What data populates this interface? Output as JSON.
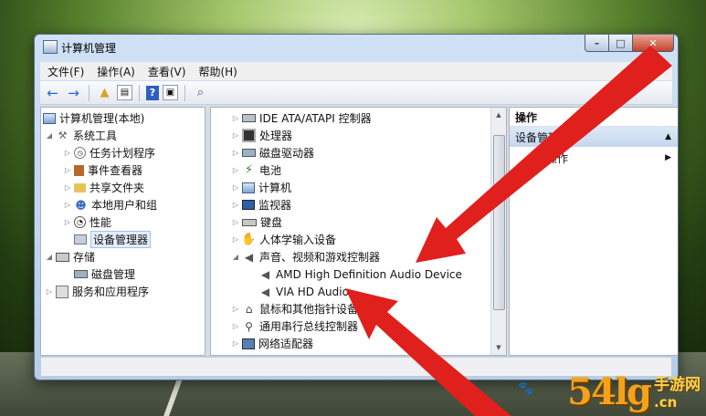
{
  "window": {
    "title": "计算机管理",
    "controls": {
      "minimize": "–",
      "maximize": "□",
      "close": "✕"
    }
  },
  "menubar": [
    {
      "label": "文件(F)"
    },
    {
      "label": "操作(A)"
    },
    {
      "label": "查看(V)"
    },
    {
      "label": "帮助(H)"
    }
  ],
  "toolbar": {
    "back_icon": "←",
    "forward_icon": "→",
    "help_icon": "?"
  },
  "left_tree": [
    {
      "label": "计算机管理(本地)",
      "icon": "computer-icon"
    },
    {
      "label": "系统工具",
      "icon": "tools-icon",
      "expander": "◢"
    },
    {
      "label": "任务计划程序",
      "icon": "clock-icon",
      "expander": "▷"
    },
    {
      "label": "事件查看器",
      "icon": "event-viewer-icon",
      "expander": "▷"
    },
    {
      "label": "共享文件夹",
      "icon": "shared-folder-icon",
      "expander": "▷"
    },
    {
      "label": "本地用户和组",
      "icon": "users-icon",
      "expander": "▷"
    },
    {
      "label": "性能",
      "icon": "performance-icon",
      "expander": "▷"
    },
    {
      "label": "设备管理器",
      "icon": "device-manager-icon",
      "selected": true
    },
    {
      "label": "存储",
      "icon": "storage-icon",
      "expander": "◢"
    },
    {
      "label": "磁盘管理",
      "icon": "disk-icon"
    },
    {
      "label": "服务和应用程序",
      "icon": "services-icon",
      "expander": "▷"
    }
  ],
  "device_tree": [
    {
      "label": "IDE ATA/ATAPI 控制器",
      "icon": "ide-controller-icon",
      "expander": "▷"
    },
    {
      "label": "处理器",
      "icon": "processor-icon",
      "expander": "▷"
    },
    {
      "label": "磁盘驱动器",
      "icon": "disk-drive-icon",
      "expander": "▷"
    },
    {
      "label": "电池",
      "icon": "battery-icon",
      "expander": "▷"
    },
    {
      "label": "计算机",
      "icon": "computer-icon",
      "expander": "▷"
    },
    {
      "label": "监视器",
      "icon": "monitor-icon",
      "expander": "▷"
    },
    {
      "label": "键盘",
      "icon": "keyboard-icon",
      "expander": "▷"
    },
    {
      "label": "人体学输入设备",
      "icon": "hid-icon",
      "expander": "▷"
    },
    {
      "label": "声音、视频和游戏控制器",
      "icon": "speaker-icon",
      "expander": "◢"
    },
    {
      "label": "AMD High Definition Audio Device",
      "icon": "speaker-icon",
      "child": true
    },
    {
      "label": "VIA HD Audio",
      "icon": "speaker-icon",
      "child": true
    },
    {
      "label": "鼠标和其他指针设备",
      "icon": "mouse-icon",
      "expander": "▷"
    },
    {
      "label": "通用串行总线控制器",
      "icon": "usb-icon",
      "expander": "▷"
    },
    {
      "label": "网络适配器",
      "icon": "network-icon",
      "expander": "▷"
    }
  ],
  "actions_pane": {
    "header": "操作",
    "group_label": "设备管理",
    "group_caret": "▲",
    "more_label": "操作",
    "more_caret": "▶"
  },
  "annotation": {
    "arrow_color": "#e0201c"
  },
  "watermark": {
    "number": "54lg",
    "site_name": "手游网",
    "domain": ".cn"
  }
}
